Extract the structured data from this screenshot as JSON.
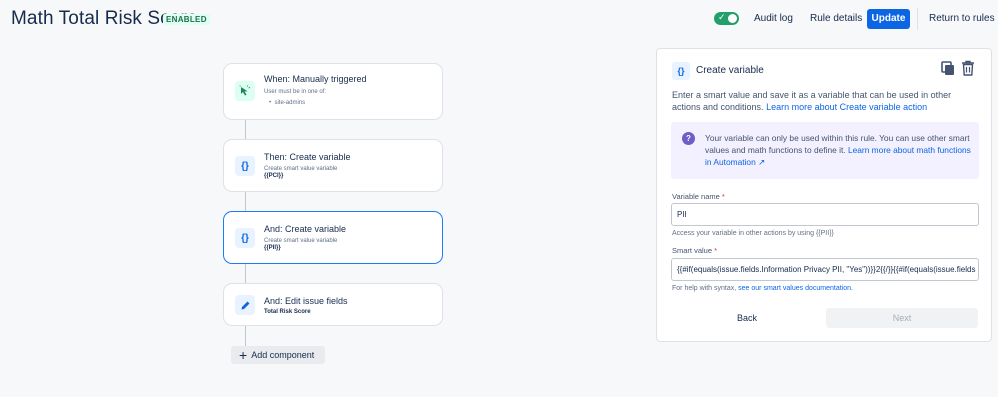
{
  "header": {
    "title": "Math Total Risk Score",
    "status_badge": "ENABLED",
    "audit_log": "Audit log",
    "rule_details": "Rule details",
    "update": "Update",
    "return_to_rules": "Return to rules",
    "toggle_on": true
  },
  "flow": {
    "trigger": {
      "title": "When: Manually triggered",
      "subtitle": "User must be in one of:",
      "list_item": "site-admins"
    },
    "step1": {
      "title": "Then: Create variable",
      "subtitle": "Create smart value variable",
      "value": "{{PCI}}"
    },
    "step2": {
      "title": "And: Create variable",
      "subtitle": "Create smart value variable",
      "value": "{{PII}}"
    },
    "step3": {
      "title": "And: Edit issue fields",
      "value": "Total Risk Score"
    },
    "add_component": "Add component"
  },
  "panel": {
    "title": "Create variable",
    "description": "Enter a smart value and save it as a variable that can be used in other actions and conditions.",
    "description_link": "Learn more about Create variable action",
    "info_text": "Your variable can only be used within this rule. You can use other smart values and math functions to define it.",
    "info_link": "Learn more about math functions in Automation ↗",
    "variable_name_label": "Variable name",
    "variable_name_value": "PII",
    "variable_name_help": "Access your variable in other actions by using {{PII}}",
    "smart_value_label": "Smart value",
    "smart_value_value": "{{#if(equals(issue.fields.Information Privacy PII, \"Yes\"))}}2{{/}}{{#if(equals(issue.fields",
    "smart_value_help_prefix": "For help with syntax,",
    "smart_value_help_link": "see our smart values documentation.",
    "back_button": "Back",
    "next_button": "Next",
    "required_mark": "*"
  },
  "colors": {
    "accent": "#0c66e4",
    "success": "#22a06b",
    "selected_border": "#1d7afc"
  },
  "icons": {
    "trigger": "cursor-click-icon",
    "variable": "curly-braces-icon",
    "edit": "pencil-icon",
    "copy": "copy-icon",
    "delete": "trash-icon",
    "info": "question-icon"
  }
}
